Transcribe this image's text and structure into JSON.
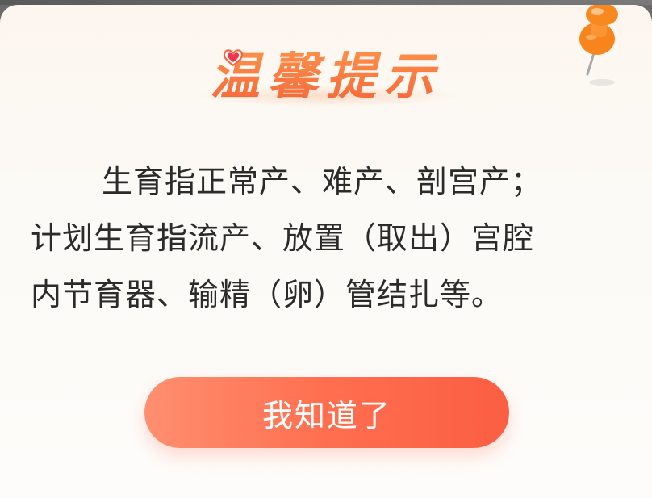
{
  "dialog": {
    "title": "温馨提示",
    "message_lines": [
      "生育指正常产、难产、剖宫产；",
      "计划生育指流产、放置（取出）宫腔",
      "内节育器、输精（卵）管结扎等。"
    ],
    "confirm_label": "我知道了",
    "accent_color": "#ff6f4f",
    "title_color": "#f5653a"
  },
  "icons": {
    "pin": "pushpin-icon",
    "heart": "heart-icon"
  }
}
